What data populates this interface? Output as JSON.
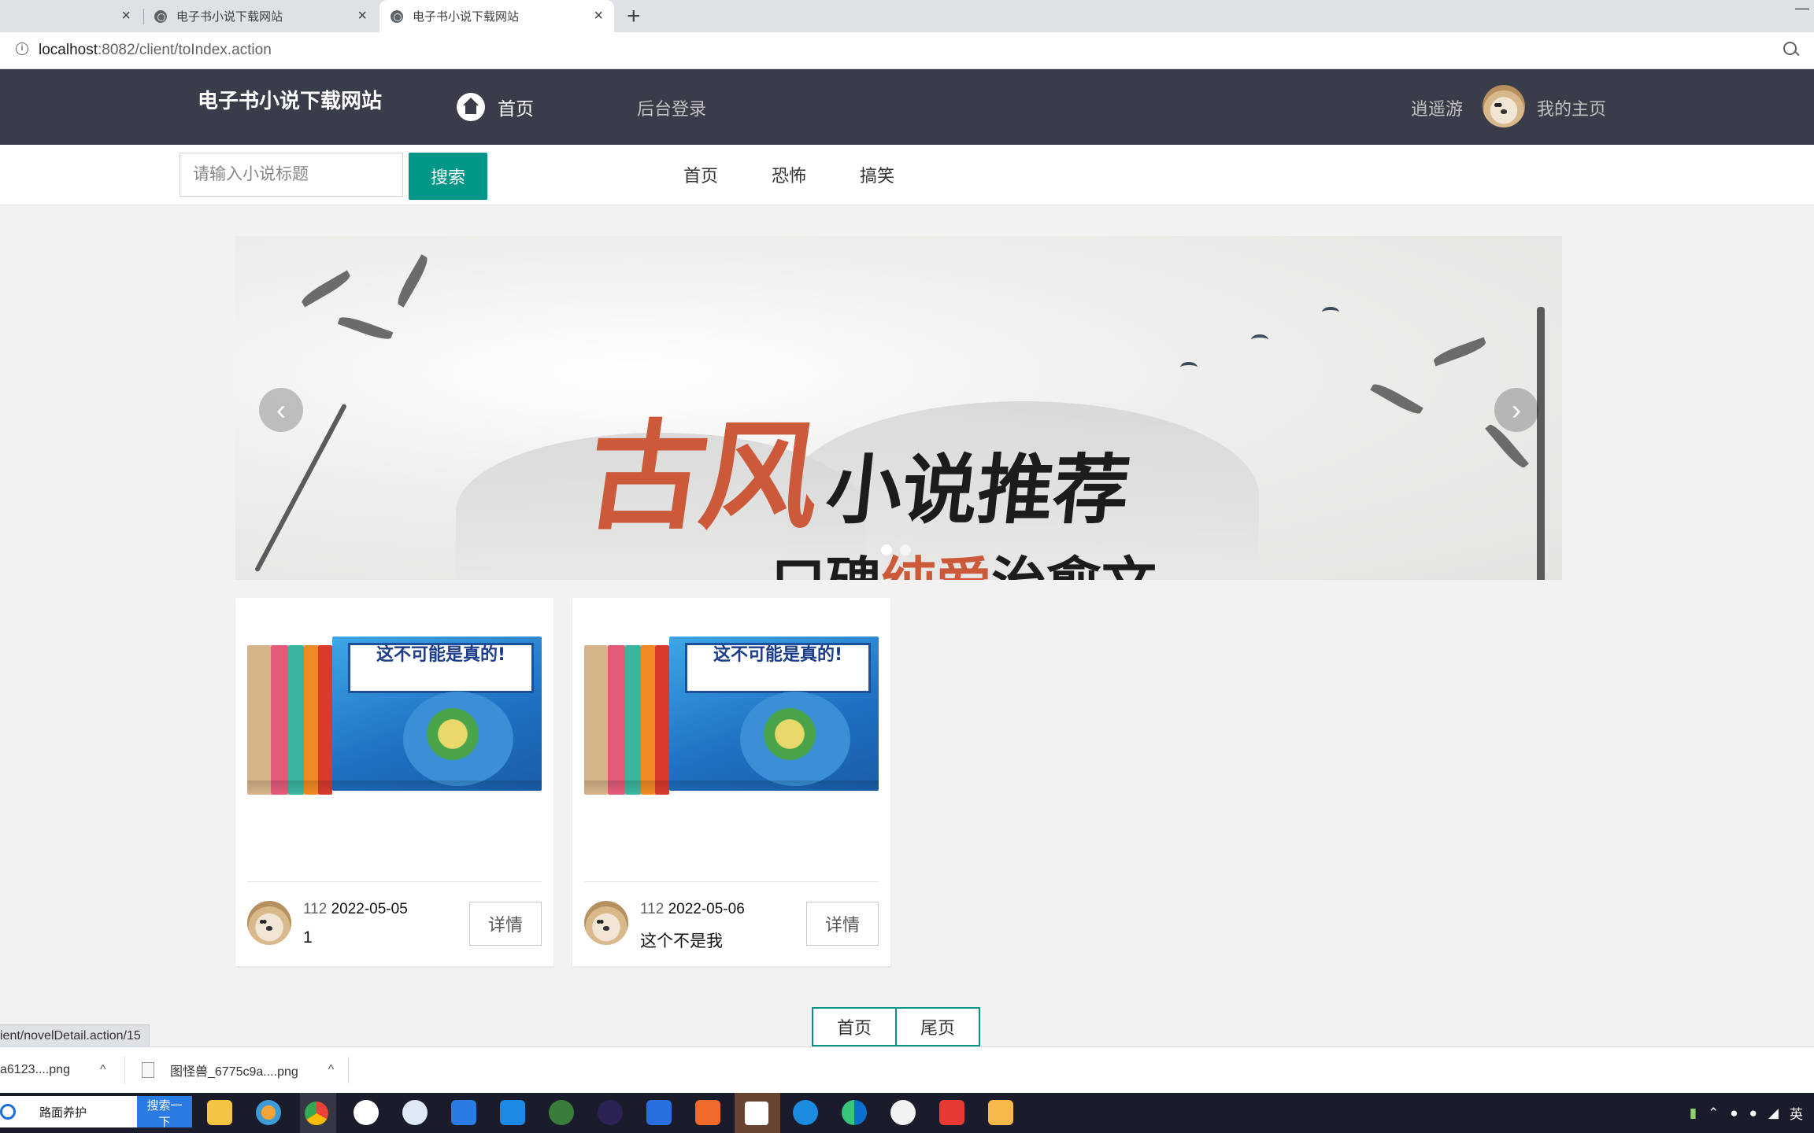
{
  "browser": {
    "tabs": [
      {
        "title": ""
      },
      {
        "title": "电子书小说下载网站"
      },
      {
        "title": "电子书小说下载网站"
      }
    ],
    "close_glyph": "×",
    "newtab_glyph": "+",
    "minimize_glyph": "—",
    "url_host": "localhost",
    "url_path": ":8082/client/toIndex.action"
  },
  "header": {
    "logo": "电子书小说下载网站",
    "home": "首页",
    "admin_login": "后台登录",
    "username": "逍遥游",
    "my_home": "我的主页"
  },
  "search": {
    "placeholder": "请输入小说标题",
    "button": "搜索"
  },
  "categories": [
    "首页",
    "恐怖",
    "搞笑"
  ],
  "carousel": {
    "main_text": "古风",
    "sub_text": "小说推荐",
    "line2_a": "口碑",
    "line2_b": "纯爱",
    "line2_c": "治愈文",
    "prev_glyph": "‹",
    "next_glyph": "›",
    "slide_count": 2,
    "active_slide": 0
  },
  "novels": [
    {
      "author": "112",
      "date": "2022-05-05",
      "title": "1",
      "detail": "详情",
      "cover_text": "这不可能是真的!"
    },
    {
      "author": "112",
      "date": "2022-05-06",
      "title": "这个不是我",
      "detail": "详情",
      "cover_text": "这不可能是真的!"
    }
  ],
  "pager": {
    "first": "首页",
    "last": "尾页"
  },
  "status_link": "ient/novelDetail.action/15",
  "downloads": [
    {
      "name": "a6123....png"
    },
    {
      "name": "图怪兽_6775c9a....png"
    }
  ],
  "downloads_chevron": "^",
  "taskbar": {
    "search_text": "路面养护",
    "search_button": "搜索一下",
    "ime": "英",
    "apps": [
      "file-explorer",
      "photos",
      "chrome",
      "baidu-netdisk",
      "settings",
      "todo",
      "notes",
      "frog-app",
      "eclipse",
      "media-player",
      "wps-slides",
      "intellij",
      "kugou",
      "edge",
      "wechat-app",
      "wps",
      "package"
    ],
    "colors": {
      "accent": "#009688",
      "header": "#393d49",
      "banner_red": "#cc5a3a"
    }
  }
}
